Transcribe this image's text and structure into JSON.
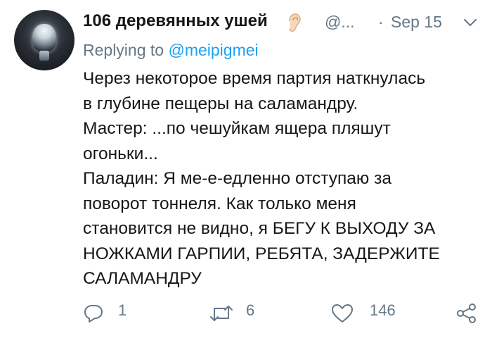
{
  "tweet": {
    "author_name": "106 деревянных ушей",
    "author_handle": "@...",
    "separator": "·",
    "date": "Sep 15",
    "replying_prefix": "Replying to",
    "replying_to": "@meipigmei",
    "body_lines": [
      "Через некоторое время партия наткнулась",
      "в глубине пещеры на саламандру.",
      "Мастер: ...по чешуйкам ящера пляшут",
      "огоньки...",
      "Паладин: Я ме-е-едленно отступаю за",
      "поворот тоннеля. Как только меня",
      "становится не видно, я БЕГУ К ВЫХОДУ ЗА",
      "НОЖКАМИ ГАРПИИ, РЕБЯТА, ЗАДЕРЖИТЕ",
      "САЛАМАНДРУ"
    ],
    "reply_count": "1",
    "retweet_count": "6",
    "like_count": "146"
  },
  "icons": {
    "name_badge": "ear-icon",
    "menu": "chevron-down-icon",
    "reply": "reply-icon",
    "retweet": "retweet-icon",
    "like": "heart-icon",
    "share": "share-icon"
  },
  "colors": {
    "text": "#14171a",
    "secondary": "#657786",
    "link": "#1da1f2",
    "icon": "#657786"
  }
}
